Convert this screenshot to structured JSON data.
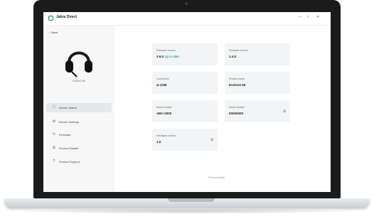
{
  "app": {
    "title": "Jabra Direct",
    "window_controls": [
      "—",
      "□",
      "✕"
    ]
  },
  "sidebar": {
    "back_label": "Back",
    "device_name": "Evolve2 65",
    "items": [
      {
        "label": "Device Status",
        "icon": "info-icon",
        "glyph": "ⓘ",
        "active": true
      },
      {
        "label": "Device Settings",
        "icon": "settings-icon",
        "glyph": "⚙",
        "active": false
      },
      {
        "label": "Firmware",
        "icon": "firmware-icon",
        "glyph": "↻",
        "active": false
      },
      {
        "label": "Product Details",
        "icon": "details-icon",
        "glyph": "☰",
        "active": false
      },
      {
        "label": "Product Support",
        "icon": "support-icon",
        "glyph": "?",
        "active": false
      }
    ]
  },
  "cards": [
    {
      "label": "Firmware version",
      "value": "3.9.0",
      "sub": "Up to date"
    },
    {
      "label": "Firmware version",
      "value": "1.4.0"
    },
    {
      "label": "Connection",
      "value": "USB",
      "icon": "usb-icon"
    },
    {
      "label": "Product name",
      "value": "Evolve2 65"
    },
    {
      "label": "Serial number",
      "value": "ABC-0000"
    },
    {
      "label": "Serial number",
      "value": "00000000",
      "copy": true
    },
    {
      "label": "Hardware version",
      "value": "1.0",
      "copy": true
    }
  ],
  "footer": {
    "link": "Product details"
  },
  "colors": {
    "accent": "#0e7a6c",
    "sidebar_bg": "#f7f7f8",
    "card_bg": "#f3f4f5"
  }
}
